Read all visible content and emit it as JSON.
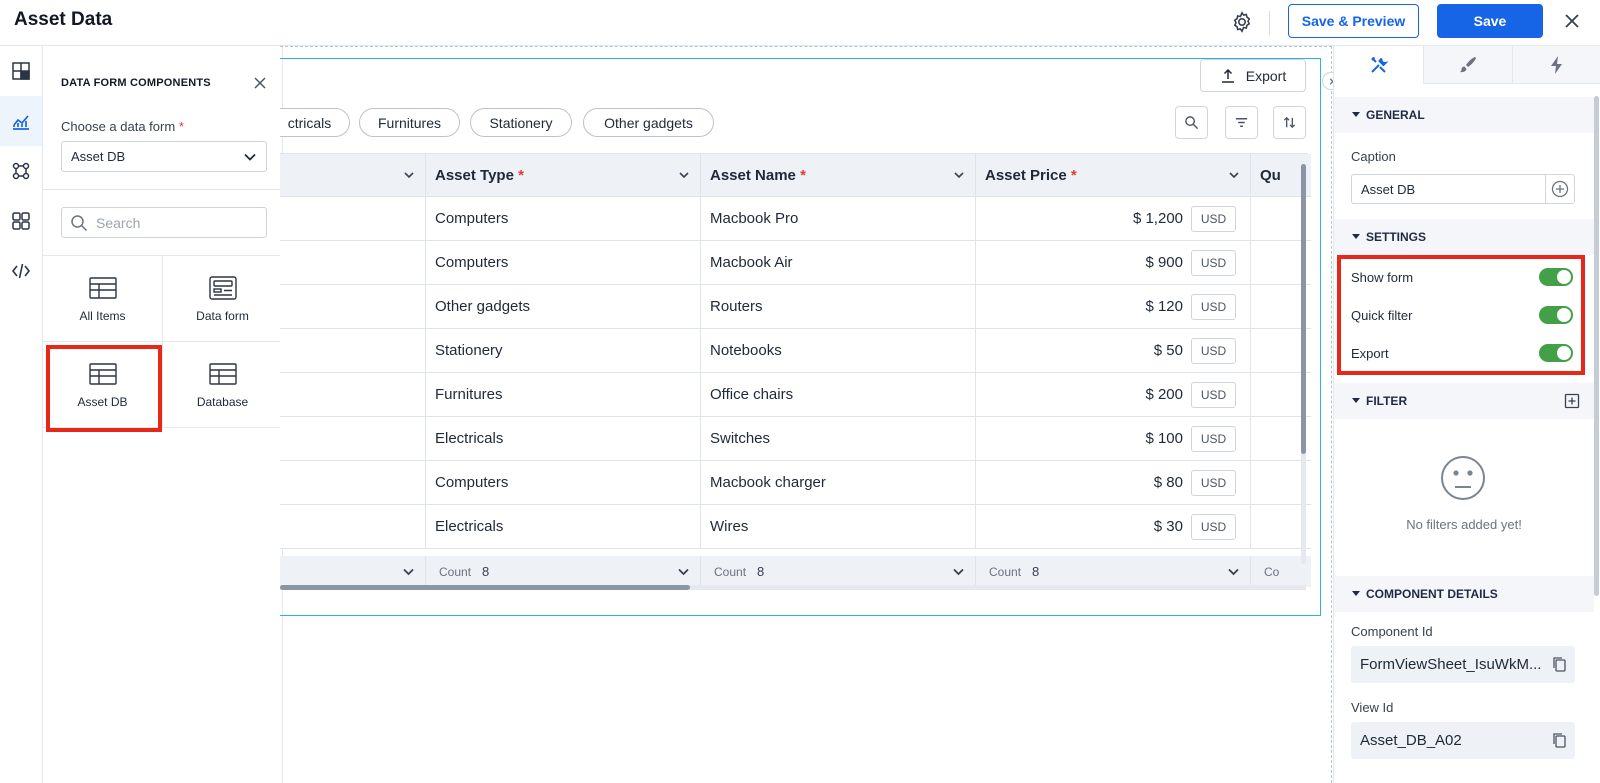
{
  "header": {
    "title": "Asset Data",
    "save_preview_label": "Save & Preview",
    "save_label": "Save"
  },
  "rail": {
    "items": [
      "layout-icon",
      "chart-icon",
      "components-icon",
      "grid-icon",
      "code-icon"
    ],
    "active_index": 1
  },
  "components_panel": {
    "title": "DATA FORM COMPONENTS",
    "choose_label": "Choose a data form",
    "required_mark": "*",
    "selected_form": "Asset DB",
    "search_placeholder": "Search",
    "tiles": [
      {
        "label": "All Items",
        "icon": "table-icon"
      },
      {
        "label": "Data form",
        "icon": "form-icon"
      },
      {
        "label": "Asset DB",
        "icon": "table-icon",
        "highlighted": true
      },
      {
        "label": "Database",
        "icon": "table-icon"
      }
    ]
  },
  "canvas": {
    "export_label": "Export",
    "filter_chips": [
      "ctricals",
      "Furnitures",
      "Stationery",
      "Other gadgets"
    ],
    "columns": [
      {
        "label": "",
        "required": false
      },
      {
        "label": "Asset Type",
        "required": true
      },
      {
        "label": "Asset Name",
        "required": true
      },
      {
        "label": "Asset Price",
        "required": true
      },
      {
        "label": "Qu",
        "required": false
      }
    ],
    "rows": [
      {
        "type": "Computers",
        "name": "Macbook Pro",
        "price": "$ 1,200",
        "currency": "USD"
      },
      {
        "type": "Computers",
        "name": "Macbook Air",
        "price": "$ 900",
        "currency": "USD"
      },
      {
        "type": "Other gadgets",
        "name": "Routers",
        "price": "$ 120",
        "currency": "USD"
      },
      {
        "type": "Stationery",
        "name": "Notebooks",
        "price": "$ 50",
        "currency": "USD"
      },
      {
        "type": "Furnitures",
        "name": "Office chairs",
        "price": "$ 200",
        "currency": "USD"
      },
      {
        "type": "Electricals",
        "name": "Switches",
        "price": "$ 100",
        "currency": "USD"
      },
      {
        "type": "Computers",
        "name": "Macbook charger",
        "price": "$ 80",
        "currency": "USD"
      },
      {
        "type": "Electricals",
        "name": "Wires",
        "price": "$ 30",
        "currency": "USD"
      }
    ],
    "footer": {
      "count_label": "Count",
      "count_value": "8",
      "partial_label": "Co"
    }
  },
  "properties": {
    "tabs": [
      "tools-icon",
      "brush-icon",
      "bolt-icon"
    ],
    "general_title": "GENERAL",
    "caption_label": "Caption",
    "caption_value": "Asset DB",
    "settings_title": "SETTINGS",
    "toggles": [
      {
        "label": "Show form",
        "on": true
      },
      {
        "label": "Quick filter",
        "on": true
      },
      {
        "label": "Export",
        "on": true
      }
    ],
    "filter_title": "FILTER",
    "no_filters_text": "No filters added yet!",
    "details_title": "COMPONENT DETAILS",
    "component_id_label": "Component Id",
    "component_id_value": "FormViewSheet_IsuWkM...",
    "view_id_label": "View Id",
    "view_id_value": "Asset_DB_A02"
  },
  "colors": {
    "accent": "#1565e6",
    "highlight": "#e8271b",
    "toggle_on": "#43a047",
    "frame_border": "#29b6d6"
  }
}
